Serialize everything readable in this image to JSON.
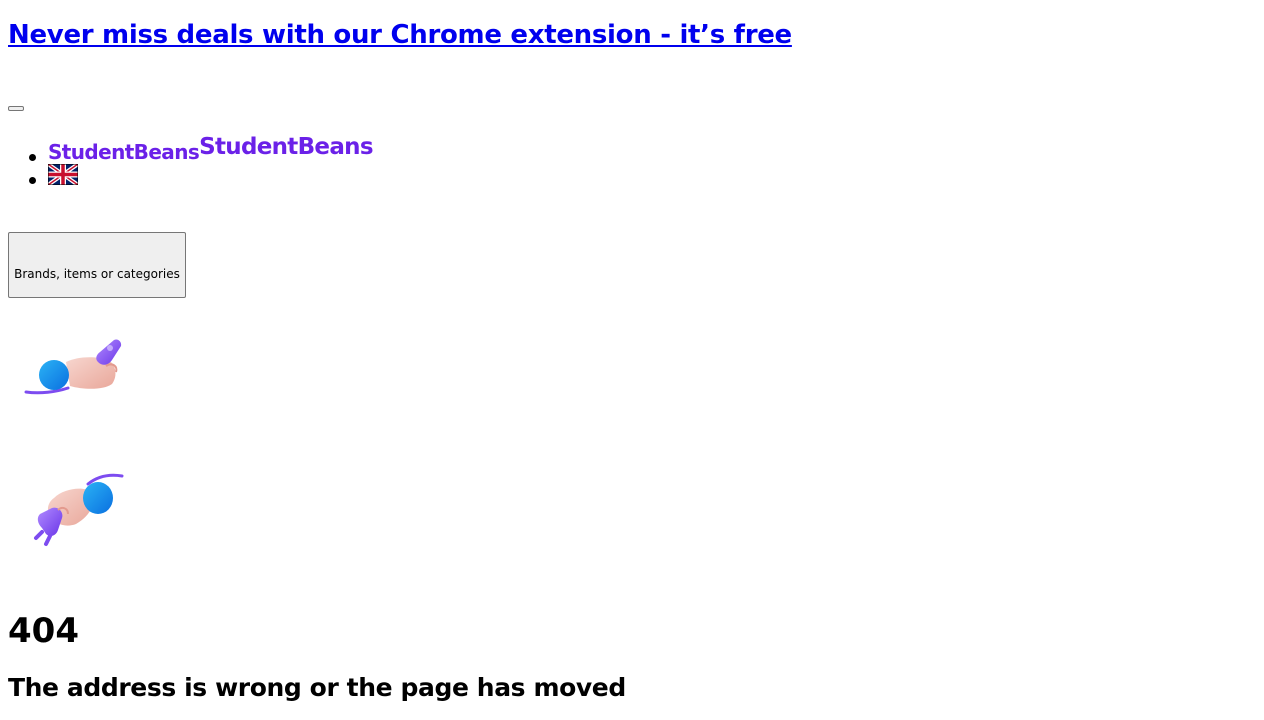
{
  "promo": {
    "link_text": "Never miss deals with our Chrome extension - it’s free"
  },
  "header": {
    "menu_icon": "menu-toggle",
    "logo_text_small": "StudentBeans",
    "logo_text_large": "StudentBeans",
    "region_flag_icon": "uk-flag-icon"
  },
  "search": {
    "label": "Brands, items or categories"
  },
  "illustrations": {
    "top_icon": "hand-plug-icon",
    "bottom_icon": "hand-socket-icon"
  },
  "error": {
    "code": "404",
    "message": "The address is wrong or the page has moved"
  },
  "colors": {
    "link": "#0000ee",
    "brand": "#6b21e8",
    "button_bg": "#efefef"
  }
}
